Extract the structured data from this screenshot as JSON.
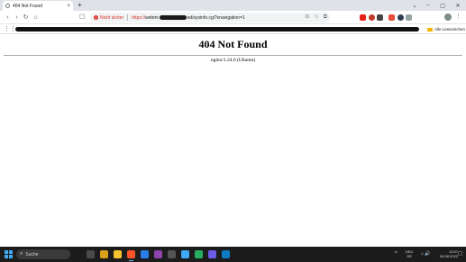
{
  "browser": {
    "tab": {
      "title": "404 Not Found",
      "close_glyph": "×"
    },
    "new_tab_glyph": "+",
    "window_controls": {
      "tab_search": "⌄",
      "minimize": "–",
      "maximize": "▢",
      "close": "✕"
    },
    "toolbar": {
      "back_glyph": "‹",
      "forward_glyph": "›",
      "reload_glyph": "↻",
      "home_glyph": "⌂",
      "bookmark_glyph": "☐",
      "insecure_label": "Nicht sicher",
      "url_scheme": "https://",
      "url_prefix": "webmi",
      "url_suffix": "ed/sysinfo.cgi?xnavigation=1",
      "omnibox_icons": [
        "⊙",
        "☆",
        "⧉"
      ],
      "menu_glyph": "⋮"
    },
    "extensions": [
      "youtube-icon",
      "extension-icon",
      "extension-icon",
      "extension-icon",
      "extension-icon",
      "extension-icon"
    ],
    "bookmarks_bar": {
      "apps_glyph": "⋮⋮",
      "all_bookmarks_label": "Alle Lesezeichen"
    }
  },
  "page": {
    "heading": "404 Not Found",
    "server": "nginx/1.24.0 (Ubuntu)"
  },
  "taskbar": {
    "search_placeholder": "Suche",
    "search_glyph": "⌕",
    "tray_arrow": "^",
    "language_line1": "DEU",
    "language_line2": "DE",
    "system_icons": "⌂ 🔊",
    "time": "13:07",
    "date": "08.08.2023",
    "notification_glyph": "◻",
    "apps": [
      {
        "name": "taskview-icon",
        "color": "#4a4a4a"
      },
      {
        "name": "files-icon",
        "color": "#d9a21b"
      },
      {
        "name": "folder-icon",
        "color": "#f4c430"
      },
      {
        "name": "brave-icon",
        "color": "#fb542b",
        "active": true
      },
      {
        "name": "app-icon",
        "color": "#2b7de9"
      },
      {
        "name": "app-icon",
        "color": "#8e44ad"
      },
      {
        "name": "calculator-icon",
        "color": "#555555"
      },
      {
        "name": "app-icon",
        "color": "#3fa9f5"
      },
      {
        "name": "vpn-icon",
        "color": "#27ae60"
      },
      {
        "name": "shield-icon",
        "color": "#6c5ce7"
      },
      {
        "name": "app-icon",
        "color": "#0e7ac4"
      }
    ]
  },
  "colors": {
    "insecure": "#d93025",
    "taskbar": "#1c1c1c",
    "accent": "#3fa9f5"
  }
}
